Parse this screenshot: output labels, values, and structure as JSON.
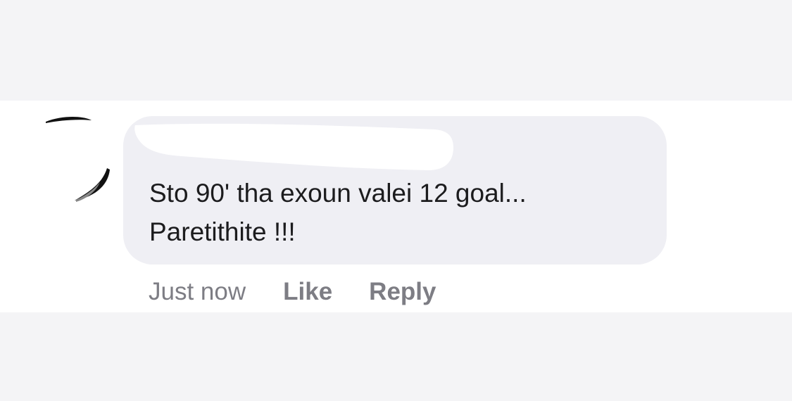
{
  "comment": {
    "author_name": "",
    "text_lines": [
      "Sto 90' tha exoun valei 12 goal...",
      "Paretithite !!!"
    ],
    "timestamp": "Just now",
    "like_label": "Like",
    "reply_label": "Reply"
  },
  "colors": {
    "page_background": "#f4f4f6",
    "row_background": "#ffffff",
    "bubble_background": "#efeff4",
    "text": "#1c1c1e",
    "secondary_text": "#7d7d84"
  },
  "icons": {
    "avatar": "avatar-icon",
    "redaction": "redaction-mark"
  }
}
